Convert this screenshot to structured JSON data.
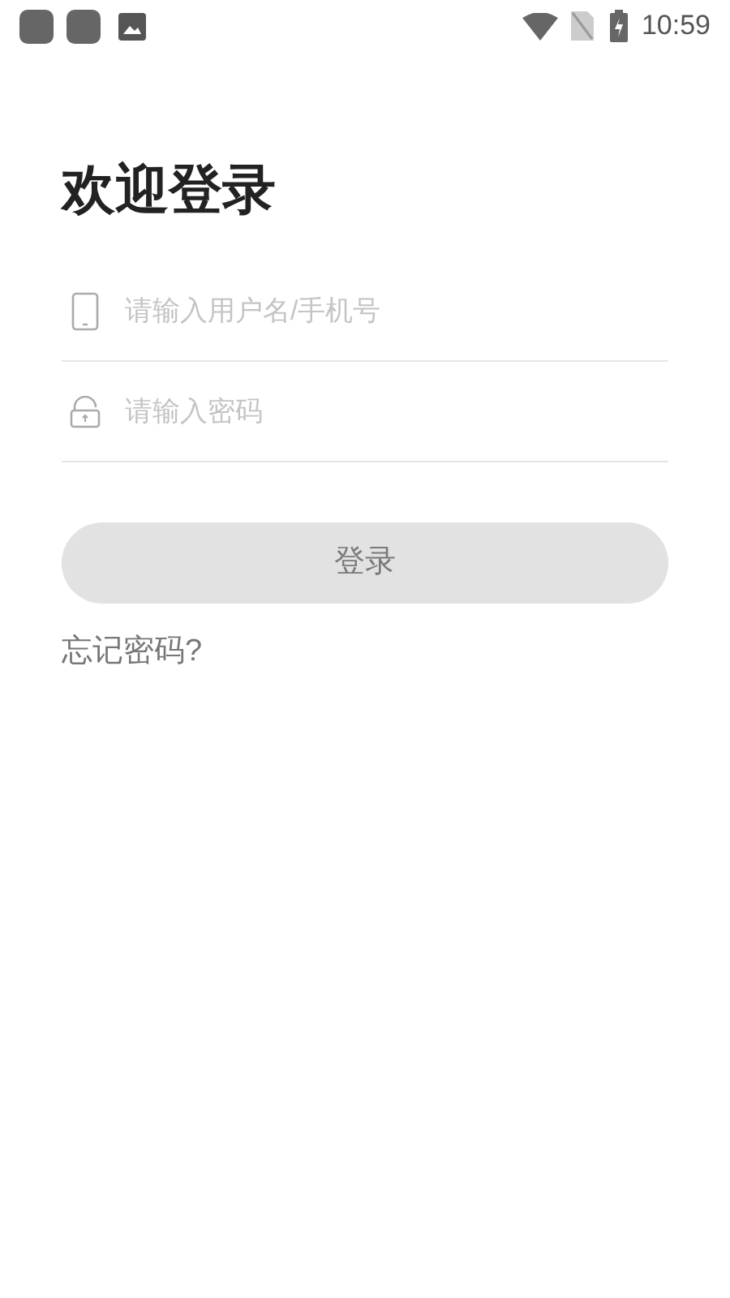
{
  "status_bar": {
    "time": "10:59"
  },
  "title": "欢迎登录",
  "fields": [
    {
      "kind": "phone",
      "placeholder": "请输入用户名/手机号"
    },
    {
      "kind": "lock",
      "placeholder": "请输入密码"
    }
  ],
  "login_button": {
    "label": "登录",
    "disabled": true
  },
  "forgot_link": "忘记密码?"
}
